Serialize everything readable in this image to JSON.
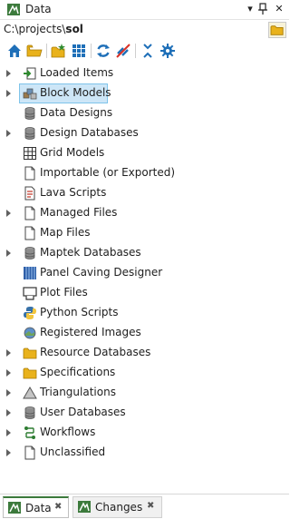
{
  "window": {
    "title": "Data",
    "pin_glyph": "▾",
    "pin_icon": "pin-icon",
    "close_glyph": "✕"
  },
  "path": {
    "prefix": "C:\\projects\\",
    "current": "sol"
  },
  "toolbar": {
    "buttons": [
      "home-icon",
      "open-folder-icon",
      "new-folder-icon",
      "grid-icon",
      "refresh-icon",
      "unlink-icon",
      "collapse-all-icon",
      "settings-icon"
    ]
  },
  "tree": {
    "items": [
      {
        "label": "Loaded Items",
        "expandable": true,
        "icon": "loaded-items-icon"
      },
      {
        "label": "Block Models",
        "expandable": true,
        "icon": "block-models-icon",
        "selected": true
      },
      {
        "label": "Data Designs",
        "expandable": false,
        "icon": "database-icon"
      },
      {
        "label": "Design Databases",
        "expandable": true,
        "icon": "database-icon"
      },
      {
        "label": "Grid Models",
        "expandable": false,
        "icon": "grid-icon"
      },
      {
        "label": "Importable (or Exported)",
        "expandable": false,
        "icon": "file-icon"
      },
      {
        "label": "Lava Scripts",
        "expandable": false,
        "icon": "script-icon"
      },
      {
        "label": "Managed Files",
        "expandable": true,
        "icon": "file-icon"
      },
      {
        "label": "Map Files",
        "expandable": false,
        "icon": "file-icon"
      },
      {
        "label": "Maptek Databases",
        "expandable": true,
        "icon": "database-icon"
      },
      {
        "label": "Panel Caving Designer",
        "expandable": false,
        "icon": "panel-caving-icon"
      },
      {
        "label": "Plot Files",
        "expandable": false,
        "icon": "plot-icon"
      },
      {
        "label": "Python Scripts",
        "expandable": false,
        "icon": "python-icon"
      },
      {
        "label": "Registered Images",
        "expandable": false,
        "icon": "image-icon"
      },
      {
        "label": "Resource Databases",
        "expandable": true,
        "icon": "folder-icon"
      },
      {
        "label": "Specifications",
        "expandable": true,
        "icon": "folder-icon"
      },
      {
        "label": "Triangulations",
        "expandable": true,
        "icon": "triangle-icon"
      },
      {
        "label": "User Databases",
        "expandable": true,
        "icon": "database-icon"
      },
      {
        "label": "Workflows",
        "expandable": true,
        "icon": "workflow-icon"
      },
      {
        "label": "Unclassified",
        "expandable": true,
        "icon": "file-icon"
      }
    ]
  },
  "tabs": [
    {
      "label": "Data",
      "active": true,
      "close": "✖"
    },
    {
      "label": "Changes",
      "active": false,
      "close": "✖"
    }
  ],
  "colors": {
    "accent": "#3c7a3c",
    "selection": "#cde6f7",
    "selection_border": "#7fc4ea",
    "toolbar_blue": "#1e6fb8"
  }
}
